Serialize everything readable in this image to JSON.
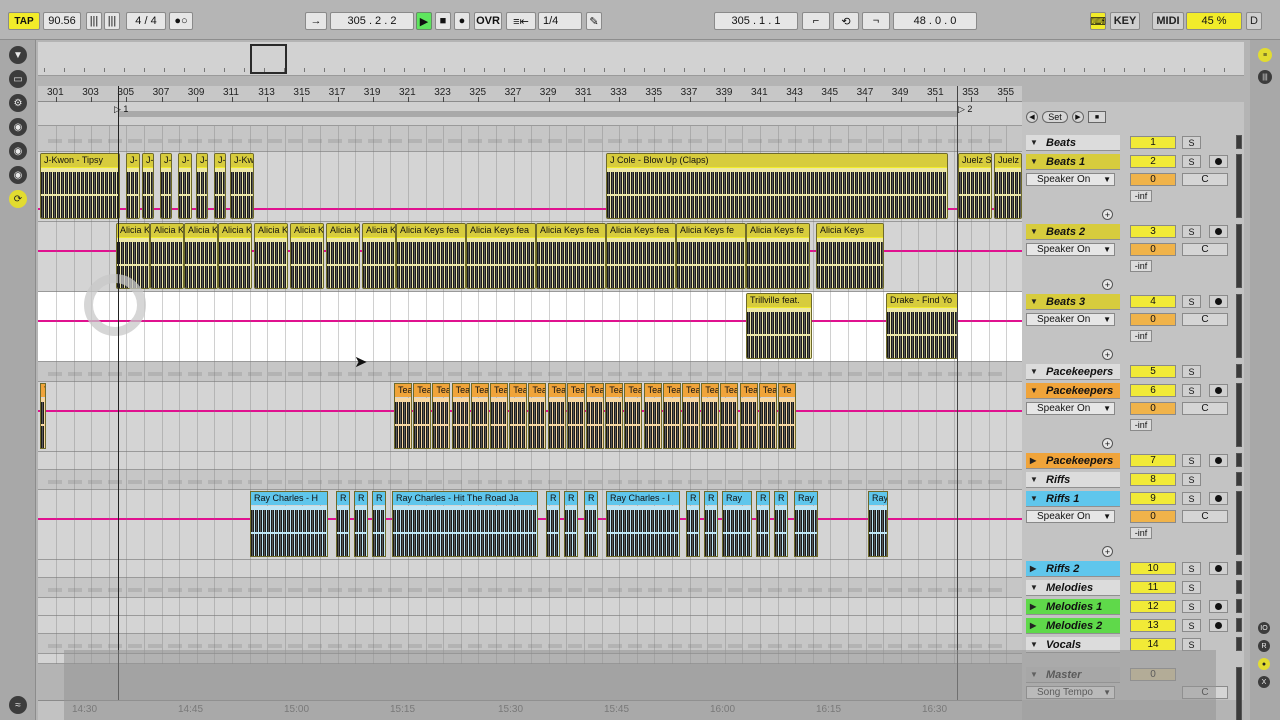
{
  "transport": {
    "tap_label": "TAP",
    "tempo": "90.56",
    "signature": "4 / 4",
    "position": "305 .  2 .  2",
    "ovr_label": "OVR",
    "quantize": "1/4",
    "loop_start": "305 .  1 .  1",
    "loop_length": "48 .  0 .  0",
    "key_label": "KEY",
    "midi_label": "MIDI",
    "cpu": "45 %",
    "d_label": "D"
  },
  "ruler": {
    "bars": [
      "301",
      "303",
      "305",
      "307",
      "309",
      "311",
      "313",
      "315",
      "317",
      "319",
      "321",
      "323",
      "325",
      "327",
      "329",
      "331",
      "333",
      "335",
      "337",
      "339",
      "341",
      "343",
      "345",
      "347",
      "349",
      "351",
      "353",
      "355"
    ],
    "loop_marker_left": "1",
    "loop_marker_right": "2"
  },
  "timeline": [
    "14:30",
    "14:45",
    "15:00",
    "15:15",
    "15:30",
    "15:45",
    "16:00",
    "16:15",
    "16:30"
  ],
  "set_label": "Set",
  "tracks": [
    {
      "name": "Beats",
      "num": "1",
      "type": "group"
    },
    {
      "name": "Beats 1",
      "num": "2",
      "input": "Speaker On",
      "vol": "0",
      "pan": "C",
      "inf": "-inf"
    },
    {
      "name": "Beats 2",
      "num": "3",
      "input": "Speaker On",
      "vol": "0",
      "pan": "C",
      "inf": "-inf"
    },
    {
      "name": "Beats 3",
      "num": "4",
      "input": "Speaker On",
      "vol": "0",
      "pan": "C",
      "inf": "-inf"
    },
    {
      "name": "Pacekeepers",
      "num": "5",
      "type": "group"
    },
    {
      "name": "Pacekeepers",
      "num": "6",
      "input": "Speaker On",
      "vol": "0",
      "pan": "C",
      "inf": "-inf"
    },
    {
      "name": "Pacekeepers",
      "num": "7"
    },
    {
      "name": "Riffs",
      "num": "8",
      "type": "group"
    },
    {
      "name": "Riffs 1",
      "num": "9",
      "input": "Speaker On",
      "vol": "0",
      "pan": "C",
      "inf": "-inf"
    },
    {
      "name": "Riffs 2",
      "num": "10"
    },
    {
      "name": "Melodies",
      "num": "11",
      "type": "group"
    },
    {
      "name": "Melodies 1",
      "num": "12"
    },
    {
      "name": "Melodies 2",
      "num": "13"
    },
    {
      "name": "Vocals",
      "num": "14",
      "type": "group"
    },
    {
      "name": "Master",
      "num": "0",
      "input": "Song Tempo",
      "pan": "C"
    }
  ],
  "clips": {
    "beats1": [
      "J-Kwon - Tipsy",
      "J-",
      "J-",
      "J-",
      "J-",
      "J-",
      "J-",
      "J-Kw",
      "J Cole - Blow Up (Claps)",
      "Juelz S",
      "Juelz"
    ],
    "beats2": [
      "Alicia K",
      "Alicia K",
      "Alicia K",
      "Alicia K",
      "Alicia K",
      "Alicia K",
      "Alicia K",
      "Alicia Keys fea",
      "Alicia Keys fea",
      "Alicia Keys fea",
      "Alicia Keys fea",
      "Alicia Keys fea",
      "Alicia Keys fe",
      "Alicia Keys fe",
      "Alicia Keys"
    ],
    "beats3": [
      "Trillville feat.",
      "Drake - Find Yo"
    ],
    "pace": [
      "To",
      "Tea",
      "Tea",
      "Tea",
      "Tea",
      "Tea",
      "Tea",
      "Tea",
      "Tea",
      "Tea",
      "Tea",
      "Tea",
      "Tea",
      "Tea",
      "Tea",
      "Tea",
      "Tea",
      "Tea",
      "Tea",
      "Tea",
      "Tea",
      "Te"
    ],
    "riffs1": [
      "Ray Charles - H",
      "R",
      "R",
      "R",
      "Ray Charles - Hit The Road Ja",
      "R",
      "R",
      "R",
      "Ray Charles - I",
      "R",
      "R",
      "Ray",
      "R",
      "R",
      "Ray",
      "Ray"
    ]
  },
  "colors": {
    "clip_yellow": "#d7cc3d",
    "clip_orange": "#f0a43a",
    "clip_blue": "#5fc6ec",
    "automation": "#e0118f",
    "play_green": "#5ee65e"
  }
}
